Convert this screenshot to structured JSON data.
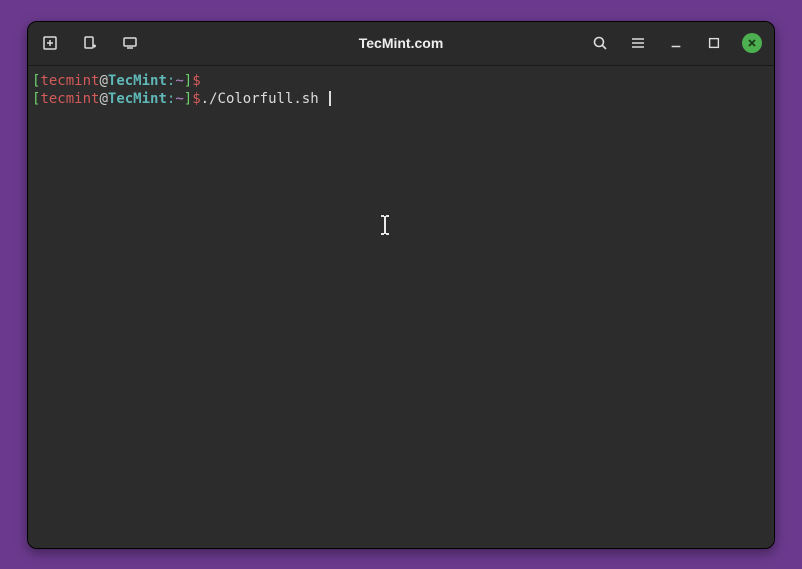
{
  "titlebar": {
    "title": "TecMint.com"
  },
  "prompt": {
    "open_bracket": "[",
    "user": "tecmint",
    "at": "@",
    "host": "TecMint",
    "colon": ":",
    "path": "~",
    "close_bracket": "]",
    "dollar": "$"
  },
  "lines": [
    {
      "command": ""
    },
    {
      "command": "./Colorfull.sh "
    }
  ]
}
